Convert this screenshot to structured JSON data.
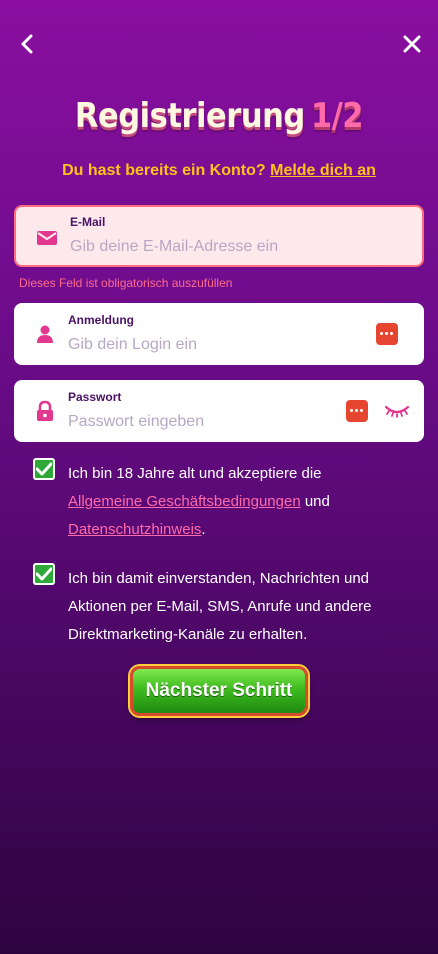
{
  "header": {
    "title": "Registrierung",
    "step": "1/2"
  },
  "login_prompt": {
    "text": "Du hast bereits ein Konto?",
    "link": "Melde dich an"
  },
  "fields": {
    "email": {
      "label": "E-Mail",
      "placeholder": "Gib deine E-Mail-Adresse ein",
      "error": "Dieses Feld ist obligatorisch auszufüllen"
    },
    "login": {
      "label": "Anmeldung",
      "placeholder": "Gib dein Login ein"
    },
    "password": {
      "label": "Passwort",
      "placeholder": "Passwort eingeben"
    }
  },
  "consents": {
    "terms": {
      "checked": true,
      "prefix": "Ich bin 18 Jahre alt und akzeptiere die",
      "link1": "Allgemeine Geschäftsbedingungen",
      "mid": "und",
      "link2": "Datenschutzhinweis",
      "suffix": "."
    },
    "marketing": {
      "checked": true,
      "text": "Ich bin damit einverstanden, Nachrichten und Aktionen per E-Mail, SMS, Anrufe und andere Direktmarketing-Kanäle zu erhalten."
    }
  },
  "next_button": "Nächster Schritt",
  "colors": {
    "accent_yellow": "#ffc21a",
    "accent_pink": "#ff6aa8",
    "error": "#ff6c7d",
    "button_green": "#3fbb1f"
  },
  "icons": [
    "back-arrow-icon",
    "close-icon",
    "envelope-icon",
    "user-icon",
    "lock-icon",
    "more-dots-icon",
    "eye-closed-icon",
    "checkmark-icon"
  ]
}
